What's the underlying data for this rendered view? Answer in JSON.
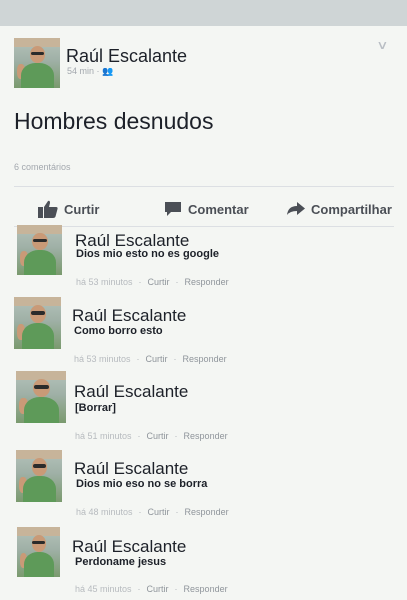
{
  "post": {
    "author": "Raúl Escalante",
    "time": "54 min",
    "text": "Hombres desnudos",
    "comments_count": "6 comentários"
  },
  "actions": {
    "like": "Curtir",
    "comment": "Comentar",
    "share": "Compartilhar"
  },
  "comments": [
    {
      "author": "Raúl Escalante",
      "text": "Dios mio esto no es google",
      "time": "há 53 minutos",
      "like": "Curtir",
      "reply": "Responder"
    },
    {
      "author": "Raúl Escalante",
      "text": "Como borro esto",
      "time": "há 53 minutos",
      "like": "Curtir",
      "reply": "Responder"
    },
    {
      "author": "Raúl Escalante",
      "text": "[Borrar]",
      "time": "há 51 minutos",
      "like": "Curtir",
      "reply": "Responder"
    },
    {
      "author": "Raúl Escalante",
      "text": "Dios mio eso no se borra",
      "time": "há 48 minutos",
      "like": "Curtir",
      "reply": "Responder"
    },
    {
      "author": "Raúl Escalante",
      "text": "Perdoname jesus",
      "time": "há 45 minutos",
      "like": "Curtir",
      "reply": "Responder"
    }
  ],
  "icons": {
    "chevron": "chevron-down-icon",
    "friends": "friends-icon",
    "like": "thumbs-up-icon",
    "comment": "comment-bubble-icon",
    "share": "share-arrow-icon"
  }
}
